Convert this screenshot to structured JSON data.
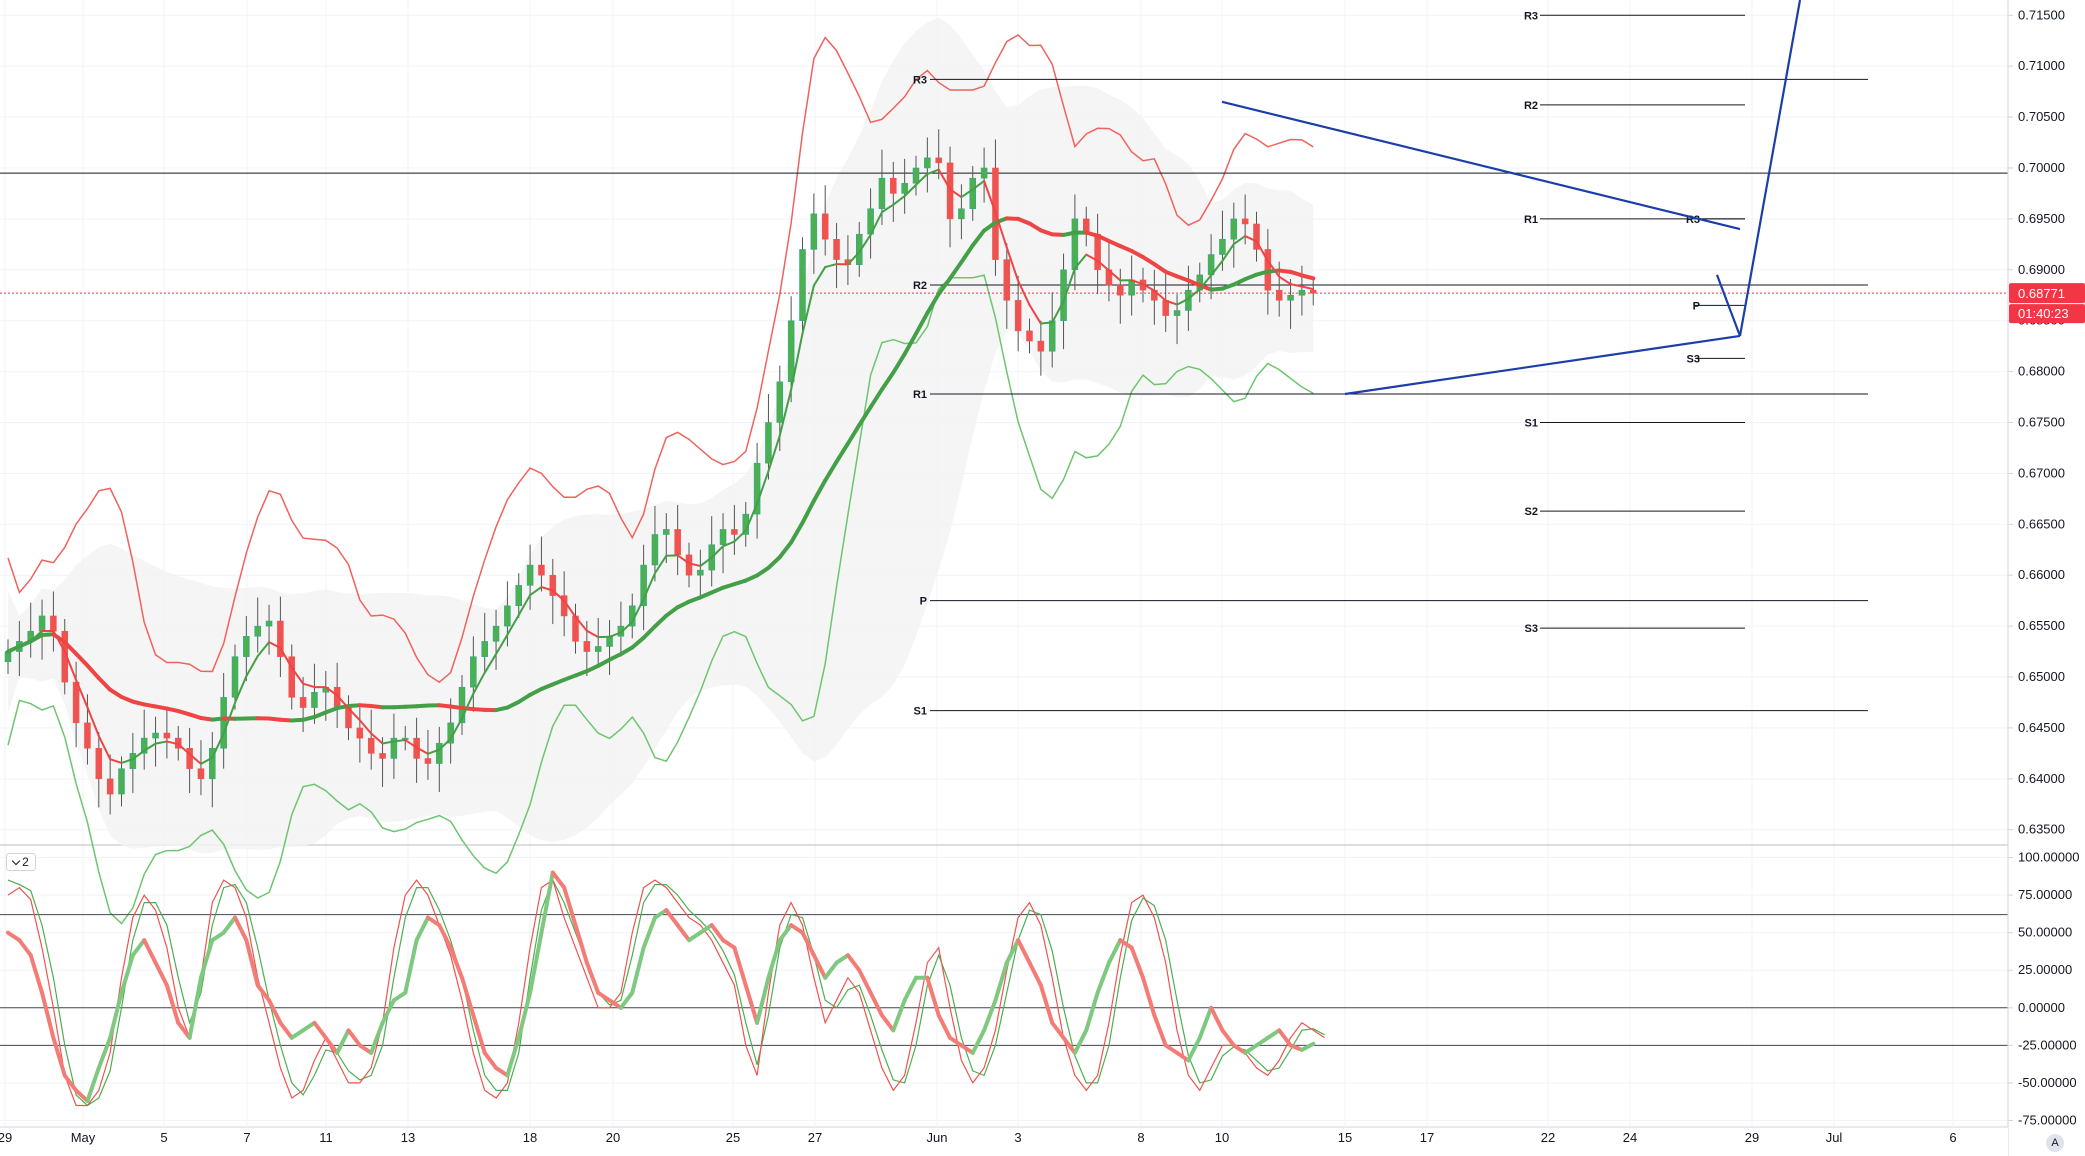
{
  "chart_data": [
    {
      "type": "candlestick",
      "name": "price-pane",
      "price_axis": [
        "0.71500",
        "0.71000",
        "0.70500",
        "0.70000",
        "0.69500",
        "0.69000",
        "0.68500",
        "0.68000",
        "0.67500",
        "0.67000",
        "0.66500",
        "0.66000",
        "0.65500",
        "0.65000",
        "0.64500",
        "0.64000",
        "0.63500"
      ],
      "ylim": [
        0.6335,
        0.7165
      ],
      "time_axis": [
        "29",
        "May",
        "5",
        "7",
        "11",
        "13",
        "18",
        "20",
        "25",
        "27",
        "Jun",
        "3",
        "8",
        "10",
        "15",
        "17",
        "22",
        "24",
        "29",
        "Jul",
        "6"
      ],
      "last_price": "0.68771",
      "countdown": "01:40:23",
      "horizontal_level": 0.6995,
      "pivots_monthly": {
        "labels": [
          "R3",
          "R2",
          "R1",
          "P",
          "S1"
        ],
        "values": [
          0.7087,
          0.6885,
          0.6778,
          0.6575,
          0.6467
        ]
      },
      "pivots_weekly": {
        "labels": [
          "R3",
          "R2",
          "R1",
          "S1",
          "S2",
          "S3"
        ],
        "values": [
          0.715,
          0.7062,
          0.695,
          0.675,
          0.6663,
          0.6548
        ]
      },
      "pivots_daily": {
        "labels": [
          "R3",
          "P",
          "S3"
        ],
        "values": [
          0.695,
          0.6865,
          0.6813
        ]
      },
      "triangle": {
        "upper": [
          [
            "Jun 10",
            0.7065
          ],
          [
            "Jun 28",
            0.694
          ]
        ],
        "lower": [
          [
            "Jun 15",
            0.6778
          ],
          [
            "Jun 28",
            0.6835
          ]
        ],
        "projection": [
          [
            "Jun 27",
            0.6895
          ],
          [
            "Jun 28",
            0.6835
          ],
          [
            "Jun 30",
            0.7165
          ]
        ]
      },
      "closes": [
        0.6525,
        0.6535,
        0.6545,
        0.656,
        0.6545,
        0.6495,
        0.6455,
        0.643,
        0.64,
        0.6385,
        0.641,
        0.6425,
        0.644,
        0.6445,
        0.644,
        0.643,
        0.641,
        0.64,
        0.643,
        0.648,
        0.652,
        0.654,
        0.655,
        0.6555,
        0.652,
        0.648,
        0.647,
        0.6485,
        0.649,
        0.647,
        0.645,
        0.644,
        0.6425,
        0.642,
        0.644,
        0.644,
        0.642,
        0.6415,
        0.6435,
        0.6455,
        0.649,
        0.652,
        0.6535,
        0.655,
        0.657,
        0.659,
        0.661,
        0.66,
        0.658,
        0.656,
        0.6535,
        0.6525,
        0.653,
        0.654,
        0.655,
        0.657,
        0.661,
        0.664,
        0.6645,
        0.662,
        0.66,
        0.6605,
        0.663,
        0.6645,
        0.664,
        0.666,
        0.671,
        0.675,
        0.679,
        0.685,
        0.692,
        0.6955,
        0.693,
        0.691,
        0.6905,
        0.6935,
        0.696,
        0.699,
        0.6975,
        0.6985,
        0.7,
        0.701,
        0.7005,
        0.695,
        0.696,
        0.699,
        0.7,
        0.691,
        0.687,
        0.684,
        0.683,
        0.682,
        0.685,
        0.69,
        0.695,
        0.6935,
        0.69,
        0.6885,
        0.6875,
        0.689,
        0.688,
        0.687,
        0.6855,
        0.686,
        0.688,
        0.6895,
        0.6915,
        0.693,
        0.695,
        0.6945,
        0.692,
        0.688,
        0.687,
        0.6875,
        0.688,
        0.6877
      ]
    },
    {
      "type": "line",
      "name": "oscillator-pane",
      "pane_badge": "2",
      "y_axis": [
        "100.00000",
        "75.00000",
        "50.00000",
        "25.00000",
        "0.00000",
        "-25.00000",
        "-50.00000",
        "-75.00000"
      ],
      "ylim": [
        -78,
        105
      ],
      "levels": [
        62,
        0,
        -25
      ],
      "series": [
        {
          "role": "signal",
          "values": [
            50,
            45,
            35,
            10,
            -20,
            -45,
            -55,
            -62,
            -40,
            -20,
            10,
            35,
            45,
            30,
            15,
            -10,
            -20,
            20,
            45,
            50,
            60,
            45,
            15,
            5,
            -10,
            -20,
            -15,
            -10,
            -20,
            -30,
            -15,
            -25,
            -30,
            -10,
            5,
            10,
            45,
            60,
            55,
            40,
            20,
            -5,
            -30,
            -40,
            -45,
            -20,
            10,
            50,
            90,
            80,
            55,
            30,
            10,
            5,
            0,
            10,
            40,
            60,
            65,
            55,
            45,
            50,
            55,
            45,
            40,
            15,
            -10,
            20,
            45,
            55,
            50,
            35,
            20,
            30,
            35,
            25,
            10,
            -5,
            -15,
            5,
            20,
            20,
            -5,
            -20,
            -25,
            -30,
            -15,
            5,
            30,
            45,
            30,
            15,
            -10,
            -20,
            -30,
            -15,
            10,
            30,
            45,
            40,
            20,
            -5,
            -25,
            -30,
            -35,
            -20,
            0,
            -15,
            -25,
            -30,
            -25,
            -20,
            -15,
            -25,
            -28,
            -24
          ]
        },
        {
          "role": "fast",
          "values": [
            75,
            80,
            72,
            40,
            0,
            -45,
            -65,
            -65,
            -55,
            -30,
            20,
            60,
            75,
            65,
            40,
            0,
            -20,
            20,
            70,
            85,
            80,
            60,
            20,
            -10,
            -40,
            -60,
            -55,
            -35,
            -20,
            -35,
            -50,
            -50,
            -40,
            -10,
            40,
            75,
            85,
            75,
            55,
            35,
            5,
            -30,
            -55,
            -60,
            -50,
            -10,
            40,
            80,
            85,
            60,
            40,
            20,
            0,
            0,
            10,
            50,
            80,
            85,
            80,
            70,
            60,
            55,
            45,
            30,
            15,
            -25,
            -45,
            10,
            55,
            70,
            55,
            20,
            -10,
            5,
            20,
            10,
            -15,
            -40,
            -55,
            -45,
            -10,
            30,
            40,
            0,
            -35,
            -50,
            -40,
            -15,
            25,
            60,
            70,
            55,
            20,
            -20,
            -45,
            -55,
            -45,
            -10,
            35,
            70,
            75,
            60,
            30,
            -15,
            -45,
            -55,
            -40,
            -25,
            -25,
            -30,
            -40,
            -45,
            -35,
            -20,
            -10,
            -15,
            -20
          ]
        },
        {
          "role": "slow",
          "values": [
            85,
            82,
            78,
            55,
            20,
            -25,
            -58,
            -65,
            -60,
            -42,
            0,
            45,
            70,
            70,
            55,
            20,
            -10,
            10,
            55,
            80,
            82,
            70,
            40,
            5,
            -25,
            -50,
            -58,
            -45,
            -28,
            -30,
            -42,
            -48,
            -45,
            -25,
            20,
            60,
            80,
            80,
            65,
            45,
            20,
            -15,
            -45,
            -55,
            -55,
            -30,
            20,
            65,
            85,
            70,
            50,
            30,
            10,
            2,
            5,
            35,
            70,
            82,
            82,
            75,
            65,
            58,
            50,
            38,
            22,
            -10,
            -38,
            -5,
            40,
            62,
            60,
            35,
            5,
            0,
            12,
            15,
            -5,
            -28,
            -48,
            -50,
            -25,
            15,
            35,
            15,
            -20,
            -42,
            -45,
            -25,
            10,
            45,
            65,
            62,
            38,
            0,
            -32,
            -50,
            -50,
            -25,
            20,
            58,
            73,
            68,
            45,
            5,
            -32,
            -50,
            -48,
            -32,
            -26,
            -28,
            -35,
            -42,
            -40,
            -28,
            -15,
            -14,
            -18
          ]
        }
      ]
    }
  ],
  "ui": {
    "auto_button": "A"
  }
}
